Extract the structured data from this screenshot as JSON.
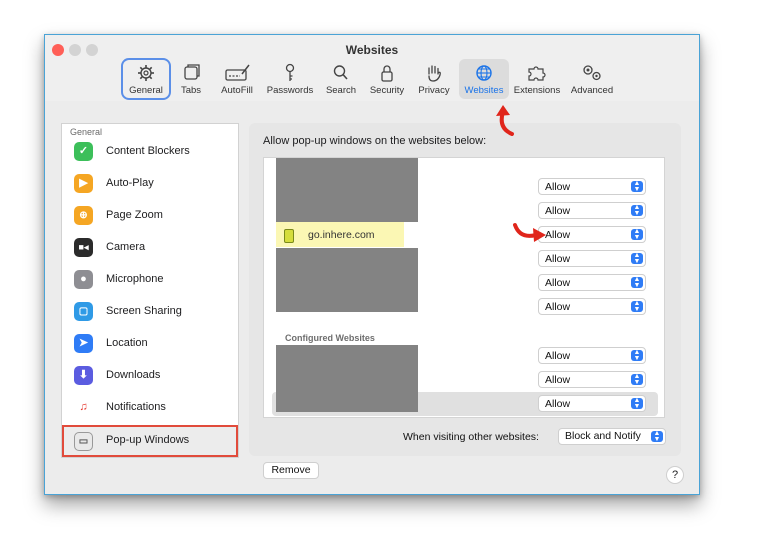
{
  "window": {
    "title": "Websites"
  },
  "toolbar": {
    "items": [
      {
        "label": "General",
        "icon": "gear-icon"
      },
      {
        "label": "Tabs",
        "icon": "tabs-icon"
      },
      {
        "label": "AutoFill",
        "icon": "autofill-icon"
      },
      {
        "label": "Passwords",
        "icon": "key-icon"
      },
      {
        "label": "Search",
        "icon": "search-icon"
      },
      {
        "label": "Security",
        "icon": "lock-icon"
      },
      {
        "label": "Privacy",
        "icon": "hand-icon"
      },
      {
        "label": "Websites",
        "icon": "globe-icon"
      },
      {
        "label": "Extensions",
        "icon": "puzzle-icon"
      },
      {
        "label": "Advanced",
        "icon": "gears-icon"
      }
    ],
    "selected": "Websites"
  },
  "sidebar": {
    "header": "General",
    "items": [
      {
        "label": "Content Blockers",
        "icon": "check-icon",
        "color": "#3cbf5a"
      },
      {
        "label": "Auto-Play",
        "icon": "play-icon",
        "color": "#f5a623"
      },
      {
        "label": "Page Zoom",
        "icon": "zoom-icon",
        "color": "#f5a623"
      },
      {
        "label": "Camera",
        "icon": "camera-icon",
        "color": "#2b2b2b"
      },
      {
        "label": "Microphone",
        "icon": "microphone-icon",
        "color": "#8e8e93"
      },
      {
        "label": "Screen Sharing",
        "icon": "screen-sharing-icon",
        "color": "#2f9ae6"
      },
      {
        "label": "Location",
        "icon": "location-icon",
        "color": "#2f7cf6"
      },
      {
        "label": "Downloads",
        "icon": "download-icon",
        "color": "#5b5ce0"
      },
      {
        "label": "Notifications",
        "icon": "bell-icon",
        "color": "#e5352b"
      },
      {
        "label": "Pop-up Windows",
        "icon": "popup-window-icon",
        "color": "#6e6e73"
      }
    ],
    "selected": "Pop-up Windows"
  },
  "main": {
    "heading": "Allow pop-up windows on the websites below:",
    "visible_site": "go.inhere.com",
    "rows": [
      {
        "value": "Allow"
      },
      {
        "value": "Allow"
      },
      {
        "value": "Allow"
      },
      {
        "value": "Allow"
      },
      {
        "value": "Allow"
      },
      {
        "value": "Allow"
      }
    ],
    "configured_title": "Configured Websites",
    "configured_rows": [
      {
        "value": "Allow"
      },
      {
        "value": "Allow"
      },
      {
        "value": "Allow"
      }
    ],
    "remove_label": "Remove",
    "visiting_label": "When visiting other websites:",
    "visiting_value": "Block and Notify",
    "help_label": "?"
  },
  "colors": {
    "accent": "#2f7cf6",
    "annotation_red": "#e0251b",
    "highlight_yellow": "#fbf7b4",
    "redaction": "#838383"
  }
}
